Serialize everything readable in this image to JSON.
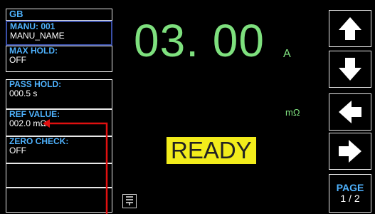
{
  "left_panel": {
    "items": [
      {
        "label": "GB",
        "value": ""
      },
      {
        "label": "MANU: 001",
        "value": "MANU_NAME"
      },
      {
        "label": "MAX HOLD:",
        "value": "OFF"
      },
      {
        "label": "PASS HOLD:",
        "value": "000.5 s"
      },
      {
        "label": "REF VALUE:",
        "value": "002.0 mΩ"
      },
      {
        "label": "ZERO CHECK:",
        "value": "OFF"
      }
    ]
  },
  "display": {
    "reading": "03. 00",
    "unit_current": "A",
    "unit_resistance": "mΩ",
    "status": "READY"
  },
  "right_panel": {
    "page_label": "PAGE",
    "page_value": "1 / 2"
  },
  "colors": {
    "reading": "#7ee07e",
    "label": "#4fb3ff",
    "ready_bg": "#f2ec1b",
    "annotation": "#e01010"
  }
}
